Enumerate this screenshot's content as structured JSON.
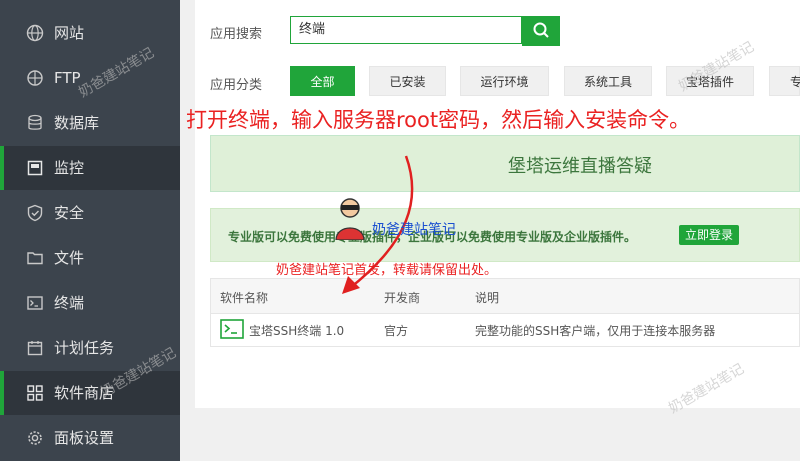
{
  "sidebar": {
    "items": [
      {
        "label": "网站",
        "icon": "globe-icon"
      },
      {
        "label": "FTP",
        "icon": "globe-small-icon"
      },
      {
        "label": "数据库",
        "icon": "database-icon"
      },
      {
        "label": "监控",
        "icon": "monitor-icon",
        "active": true
      },
      {
        "label": "安全",
        "icon": "shield-icon"
      },
      {
        "label": "文件",
        "icon": "folder-icon"
      },
      {
        "label": "终端",
        "icon": "terminal-icon"
      },
      {
        "label": "计划任务",
        "icon": "calendar-icon"
      },
      {
        "label": "软件商店",
        "icon": "grid-icon",
        "active": true
      },
      {
        "label": "面板设置",
        "icon": "gear-icon"
      }
    ]
  },
  "search": {
    "label": "应用搜索",
    "value": "终端"
  },
  "categories": {
    "label": "应用分类",
    "items": [
      "全部",
      "已安装",
      "运行环境",
      "系统工具",
      "宝塔插件",
      "专"
    ]
  },
  "annotation": {
    "instruction": "打开终端，输入服务器root密码，然后输入安装命令。",
    "credit": "奶爸建站笔记首发，转载请保留出处。",
    "watermark": "奶爸建站笔记"
  },
  "banner": {
    "title": "堡塔运维直播答疑"
  },
  "pro_banner": {
    "text": "专业版可以免费使用专业版插件，企业版可以免费使用专业版及企业版插件。",
    "button": "立即登录"
  },
  "table": {
    "headers": [
      "软件名称",
      "开发商",
      "说明"
    ],
    "rows": [
      {
        "name": "宝塔SSH终端 1.0",
        "developer": "官方",
        "description": "完整功能的SSH客户端，仅用于连接本服务器"
      }
    ]
  },
  "colors": {
    "accent": "#20a53a",
    "sidebar": "#3c444d",
    "annotation": "#ea2222"
  }
}
